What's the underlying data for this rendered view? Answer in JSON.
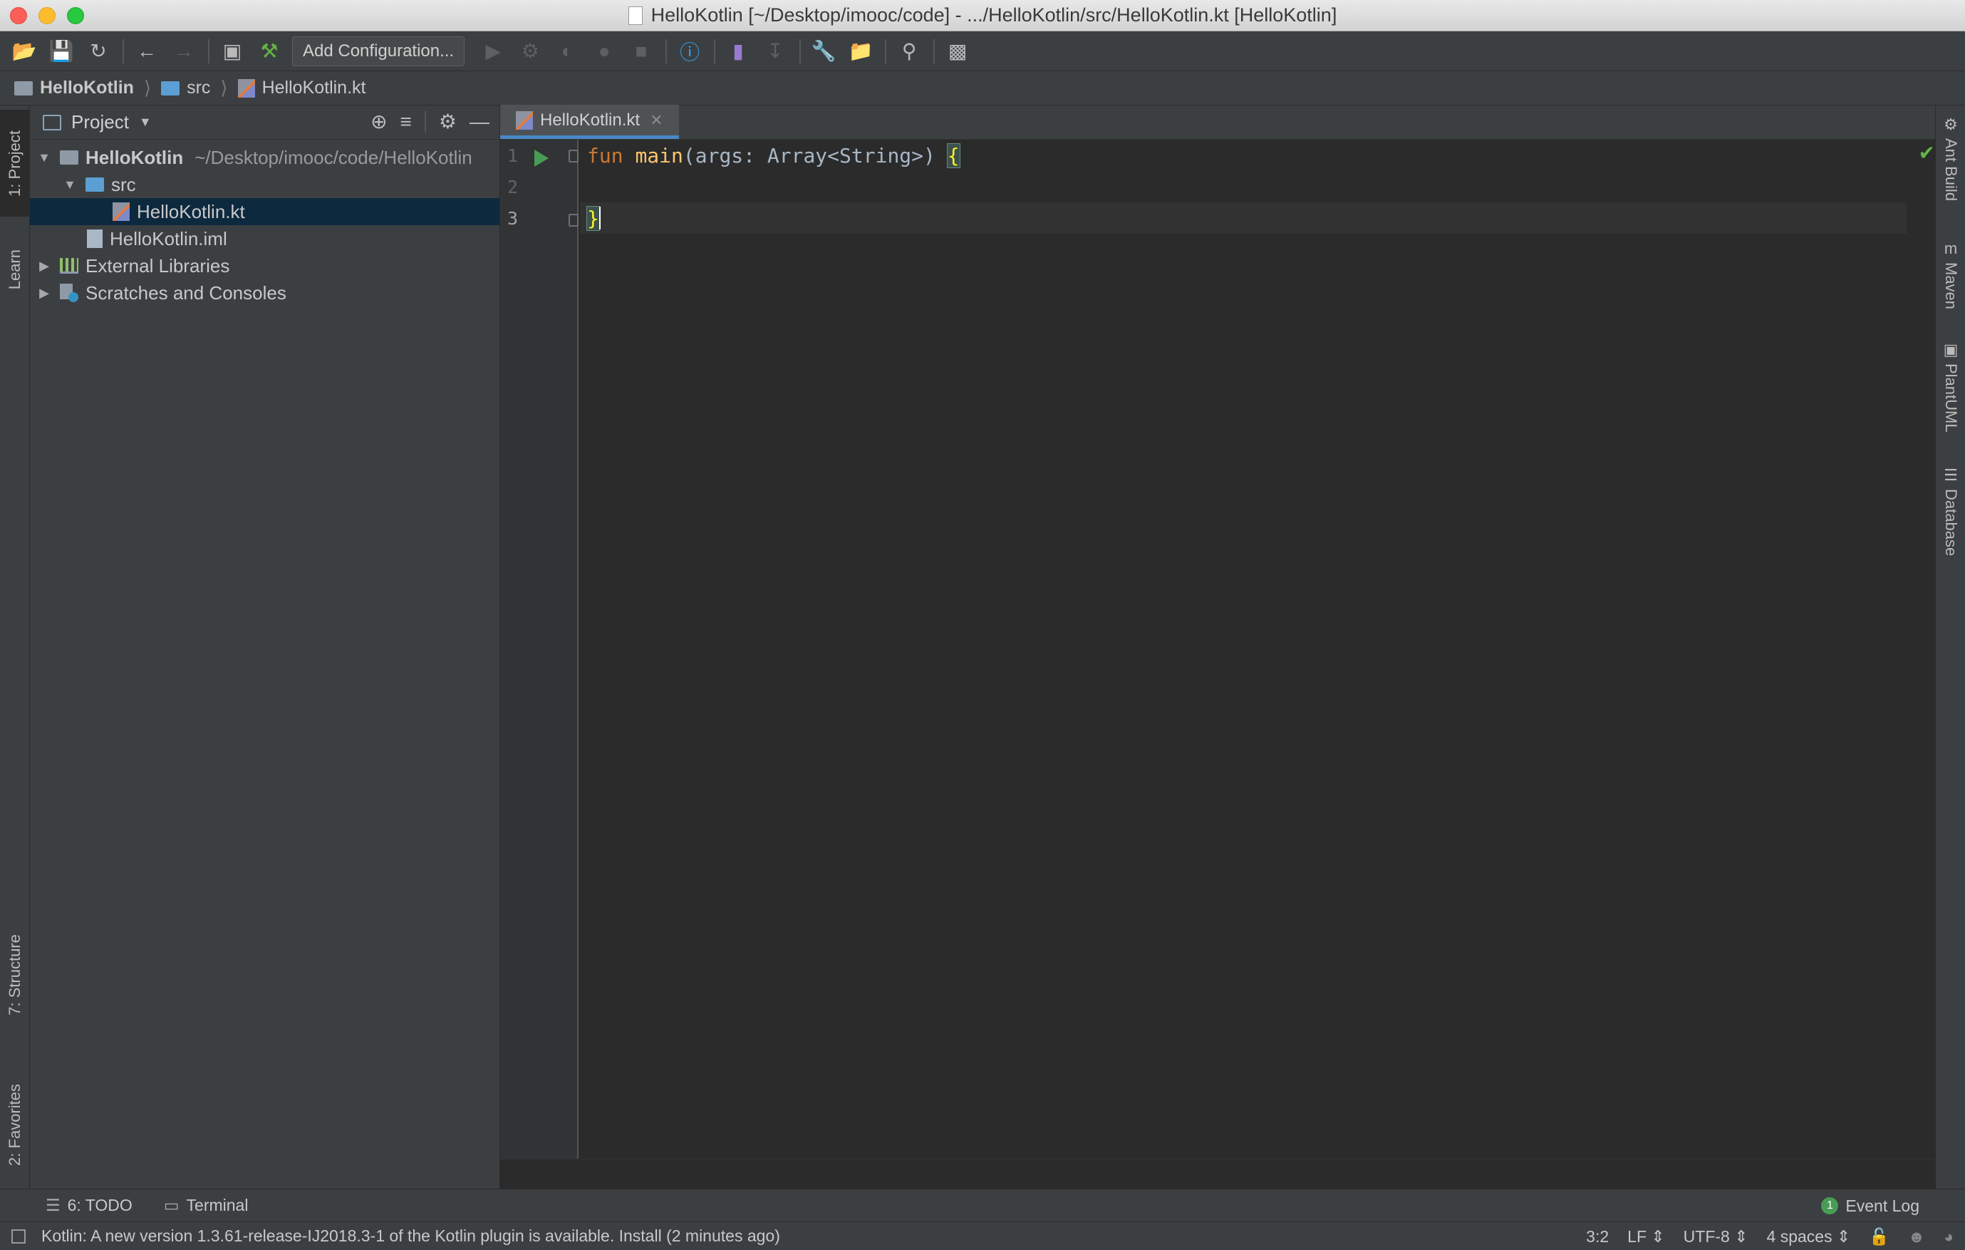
{
  "window": {
    "title": "HelloKotlin [~/Desktop/imooc/code] - .../HelloKotlin/src/HelloKotlin.kt [HelloKotlin]"
  },
  "toolbar": {
    "add_configuration_label": "Add Configuration..."
  },
  "breadcrumb": {
    "items": [
      "HelloKotlin",
      "src",
      "HelloKotlin.kt"
    ]
  },
  "left_strip": {
    "tabs": [
      "1: Project",
      "Learn",
      "7: Structure",
      "2: Favorites"
    ]
  },
  "project_panel": {
    "title": "Project",
    "tree": [
      {
        "label": "HelloKotlin",
        "path": "~/Desktop/imooc/code/HelloKotlin",
        "expanded": true
      },
      {
        "label": "src",
        "expanded": true
      },
      {
        "label": "HelloKotlin.kt",
        "selected": true
      },
      {
        "label": "HelloKotlin.iml"
      },
      {
        "label": "External Libraries",
        "expanded": false
      },
      {
        "label": "Scratches and Consoles",
        "expanded": false
      }
    ]
  },
  "editor": {
    "tab_label": "HelloKotlin.kt",
    "line_numbers": [
      "1",
      "2",
      "3"
    ],
    "code": {
      "line1_kw": "fun",
      "line1_fn": "main",
      "line1_rest": "(args: Array<String>) ",
      "line1_brace": "{",
      "line3_brace": "}"
    }
  },
  "right_strip": {
    "tabs": [
      "Ant Build",
      "Maven",
      "PlantUML",
      "Database"
    ]
  },
  "bottom_tools": {
    "todo": "6: TODO",
    "terminal": "Terminal",
    "event_log": "Event Log",
    "event_count": "1"
  },
  "status_bar": {
    "message": "Kotlin: A new version 1.3.61-release-IJ2018.3-1 of the Kotlin plugin is available. Install (2 minutes ago)",
    "position": "3:2",
    "line_separator": "LF",
    "encoding": "UTF-8",
    "indent": "4 spaces"
  },
  "colors": {
    "accent": "#4a88c7",
    "keyword": "#cc7832",
    "function": "#ffc66d",
    "text": "#a9b7c6",
    "selection": "#0d293e"
  }
}
